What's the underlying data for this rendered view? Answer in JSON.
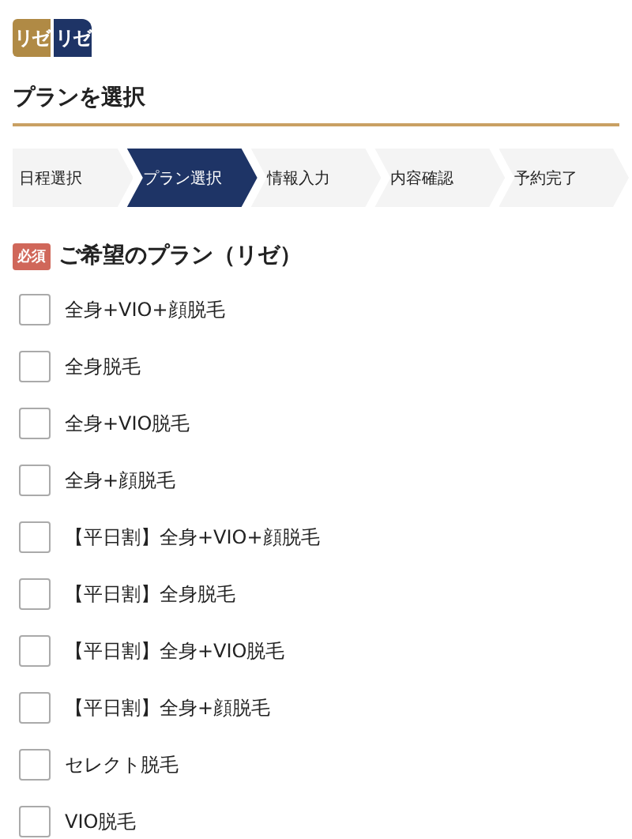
{
  "logo": [
    "リゼ",
    "リゼ"
  ],
  "title": "プランを選択",
  "steps": [
    {
      "label": "日程選択",
      "selected": false
    },
    {
      "label": "プラン選択",
      "selected": true
    },
    {
      "label": "情報入力",
      "selected": false
    },
    {
      "label": "内容確認",
      "selected": false
    },
    {
      "label": "予約完了",
      "selected": false
    }
  ],
  "section": {
    "badge": "必須",
    "heading": "ご希望のプラン（リゼ）"
  },
  "plans": [
    {
      "label": "全身+VIO+顔脱毛",
      "checked": false
    },
    {
      "label": "全身脱毛",
      "checked": false
    },
    {
      "label": "全身+VIO脱毛",
      "checked": false
    },
    {
      "label": "全身+顔脱毛",
      "checked": false
    },
    {
      "label": "【平日割】全身+VIO+顔脱毛",
      "checked": false
    },
    {
      "label": "【平日割】全身脱毛",
      "checked": false
    },
    {
      "label": "【平日割】全身+VIO脱毛",
      "checked": false
    },
    {
      "label": "【平日割】全身+顔脱毛",
      "checked": false
    },
    {
      "label": "セレクト脱毛",
      "checked": false
    },
    {
      "label": "VIO脱毛",
      "checked": false
    }
  ]
}
